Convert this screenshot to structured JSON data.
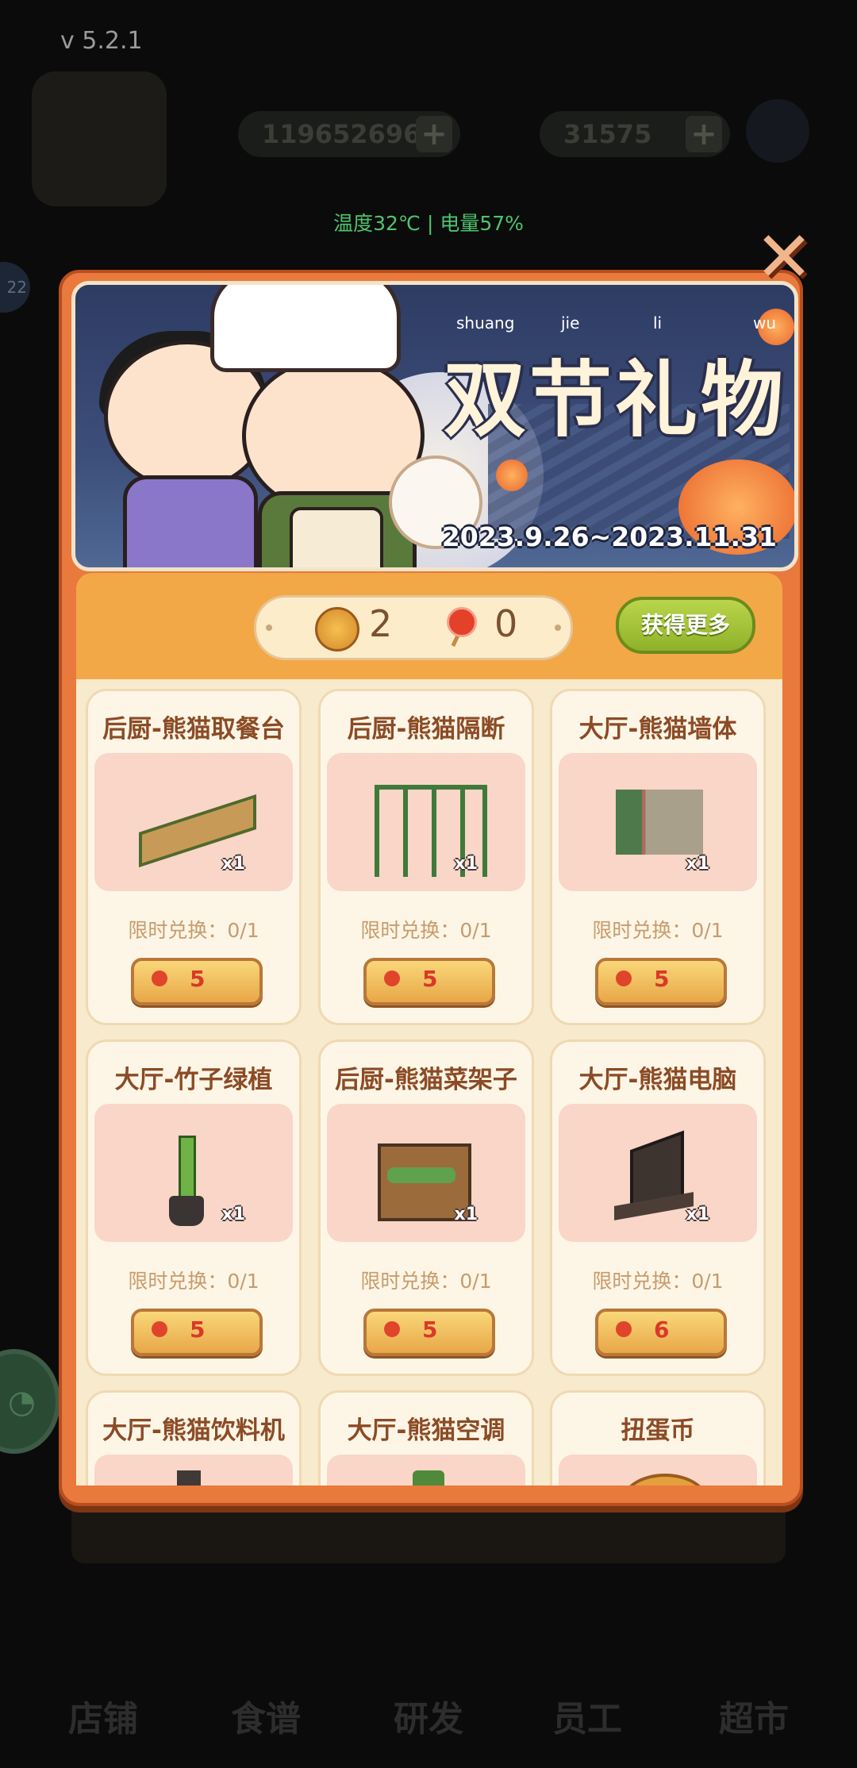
{
  "version": "v 5.2.1",
  "background": {
    "coins": "119652696",
    "gems": "31575",
    "level": "22",
    "nav_tabs": [
      "店铺",
      "食谱",
      "研发",
      "员工",
      "超市"
    ]
  },
  "status": "温度32℃ | 电量57%",
  "dialog": {
    "banner": {
      "title": "双节礼物",
      "pinyin": [
        "shuang",
        "jie",
        "li",
        "wu"
      ],
      "date_range": "2023.9.26~2023.11.31"
    },
    "currency": {
      "mooncake_count": "2",
      "candy_count": "0",
      "get_more_label": "获得更多"
    },
    "items": [
      {
        "name": "后厨-熊猫取餐台",
        "qty": "x1",
        "limit": "限时兑换：0/1",
        "price": "5",
        "icon": "counter-icon"
      },
      {
        "name": "后厨-熊猫隔断",
        "qty": "x1",
        "limit": "限时兑换：0/1",
        "price": "5",
        "icon": "partition-icon"
      },
      {
        "name": "大厅-熊猫墙体",
        "qty": "x1",
        "limit": "限时兑换：0/1",
        "price": "5",
        "icon": "wall-icon"
      },
      {
        "name": "大厅-竹子绿植",
        "qty": "x1",
        "limit": "限时兑换：0/1",
        "price": "5",
        "icon": "bamboo-icon"
      },
      {
        "name": "后厨-熊猫菜架子",
        "qty": "x1",
        "limit": "限时兑换：0/1",
        "price": "5",
        "icon": "vegetable-rack-icon"
      },
      {
        "name": "大厅-熊猫电脑",
        "qty": "x1",
        "limit": "限时兑换：0/1",
        "price": "6",
        "icon": "computer-icon"
      },
      {
        "name": "大厅-熊猫饮料机",
        "icon": "drink-machine-icon"
      },
      {
        "name": "大厅-熊猫空调",
        "icon": "air-conditioner-icon"
      },
      {
        "name": "扭蛋币",
        "icon": "gacha-coin-icon"
      }
    ],
    "close_icon": "close-icon"
  }
}
